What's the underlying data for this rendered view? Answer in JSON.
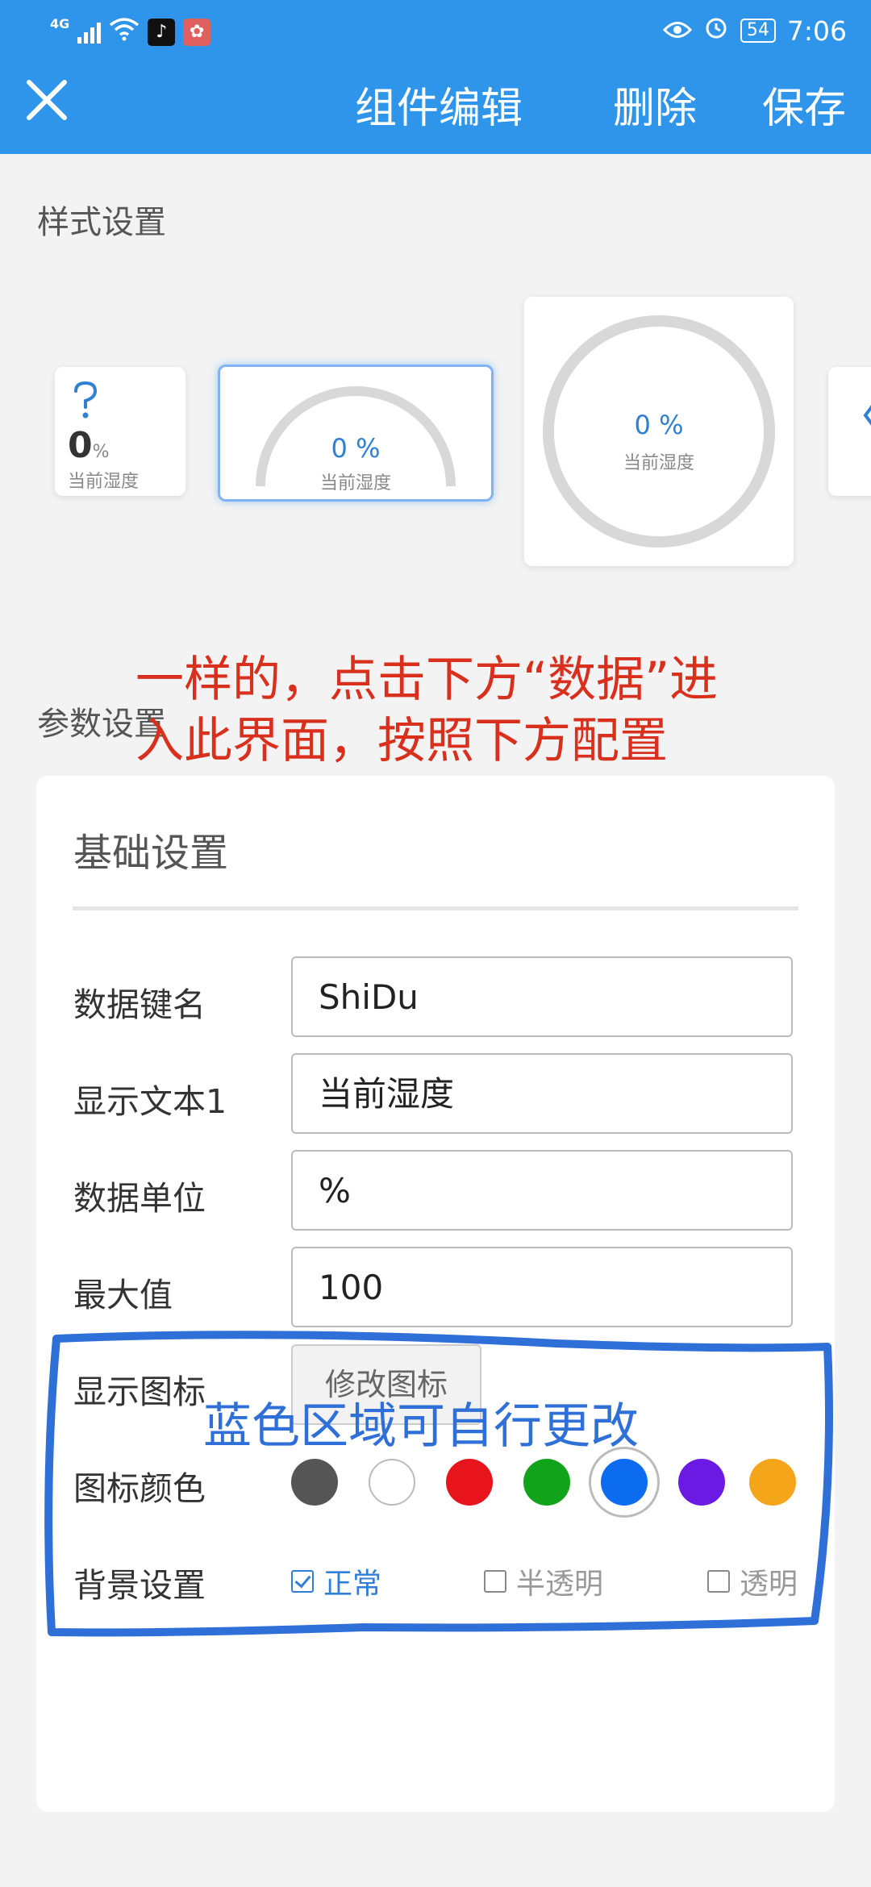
{
  "status_bar": {
    "network": "4G",
    "battery": "54",
    "time": "7:06",
    "icons": [
      "signal-icon",
      "wifi-icon",
      "tiktok-icon",
      "huawei-icon",
      "eye-icon",
      "alarm-icon",
      "battery-icon"
    ]
  },
  "header": {
    "title": "组件编辑",
    "delete_label": "删除",
    "save_label": "保存",
    "close_icon": "close-icon"
  },
  "style_section": {
    "label": "样式设置",
    "tiles": [
      {
        "type": "icon-value",
        "value": "0",
        "unit": "%",
        "label": "当前湿度",
        "icon": "question-icon"
      },
      {
        "type": "half-gauge",
        "value_text": "0 %",
        "label": "当前湿度",
        "selected": true
      },
      {
        "type": "ring-gauge",
        "value_text": "0 %",
        "label": "当前湿度"
      },
      {
        "type": "partial",
        "icon": "chevron-left-icon"
      }
    ]
  },
  "params_section": {
    "label": "参数设置"
  },
  "annotation_red": {
    "line1": "一样的，点击下方“数据”进",
    "line2": "入此界面，按照下方配置"
  },
  "basic_settings": {
    "title": "基础设置",
    "fields": [
      {
        "label": "数据键名",
        "value": "ShiDu"
      },
      {
        "label": "显示文本1",
        "value": "当前湿度"
      },
      {
        "label": "数据单位",
        "value": "%"
      },
      {
        "label": "最大值",
        "value": "100"
      }
    ],
    "icon_row": {
      "label": "显示图标",
      "button": "修改图标"
    },
    "color_row": {
      "label": "图标颜色",
      "colors": [
        "#555555",
        "#ffffff",
        "#e8141b",
        "#11a31a",
        "#0b6cf0",
        "#6b1ae3",
        "#f5a519"
      ],
      "selected_index": 4
    },
    "bg_row": {
      "label": "背景设置",
      "options": [
        {
          "label": "正常",
          "checked": true
        },
        {
          "label": "半透明",
          "checked": false
        },
        {
          "label": "透明",
          "checked": false
        }
      ]
    }
  },
  "annotation_blue": {
    "text": "蓝色区域可自行更改",
    "color": "#2f6fd8"
  }
}
